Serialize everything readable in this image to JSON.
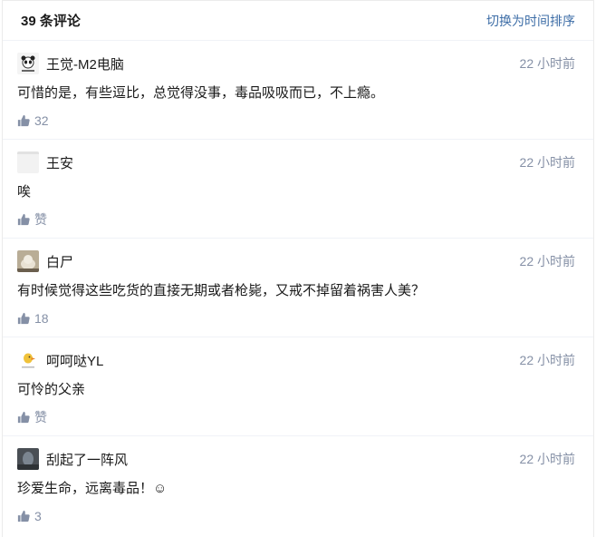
{
  "header": {
    "count_label": "39 条评论",
    "sort_label": "切换为时间排序"
  },
  "comments": [
    {
      "author": "王觉-M2电脑",
      "time": "22 小时前",
      "content": "可惜的是，有些逗比，总觉得没事，毒品吸吸而已，不上瘾。",
      "likes": "32",
      "avatar": "avatar-panda"
    },
    {
      "author": "王安",
      "time": "22 小时前",
      "content": "唉",
      "likes": "赞",
      "avatar": "avatar-blank"
    },
    {
      "author": "白尸",
      "time": "22 小时前",
      "content": "有时候觉得这些吃货的直接无期或者枪毙，又戒不掉留着祸害人美？",
      "likes": "18",
      "avatar": "avatar-cat"
    },
    {
      "author": "呵呵哒YL",
      "time": "22 小时前",
      "content": "可怜的父亲",
      "likes": "赞",
      "avatar": "avatar-duck"
    },
    {
      "author": "刮起了一阵风",
      "time": "22 小时前",
      "content": "珍爱生命，远离毒品！☺",
      "likes": "3",
      "avatar": "avatar-dark"
    }
  ],
  "colors": {
    "link": "#3e6ea7",
    "meta": "#8590a6",
    "text": "#1a1a1a",
    "divider": "#f0f2f7"
  }
}
